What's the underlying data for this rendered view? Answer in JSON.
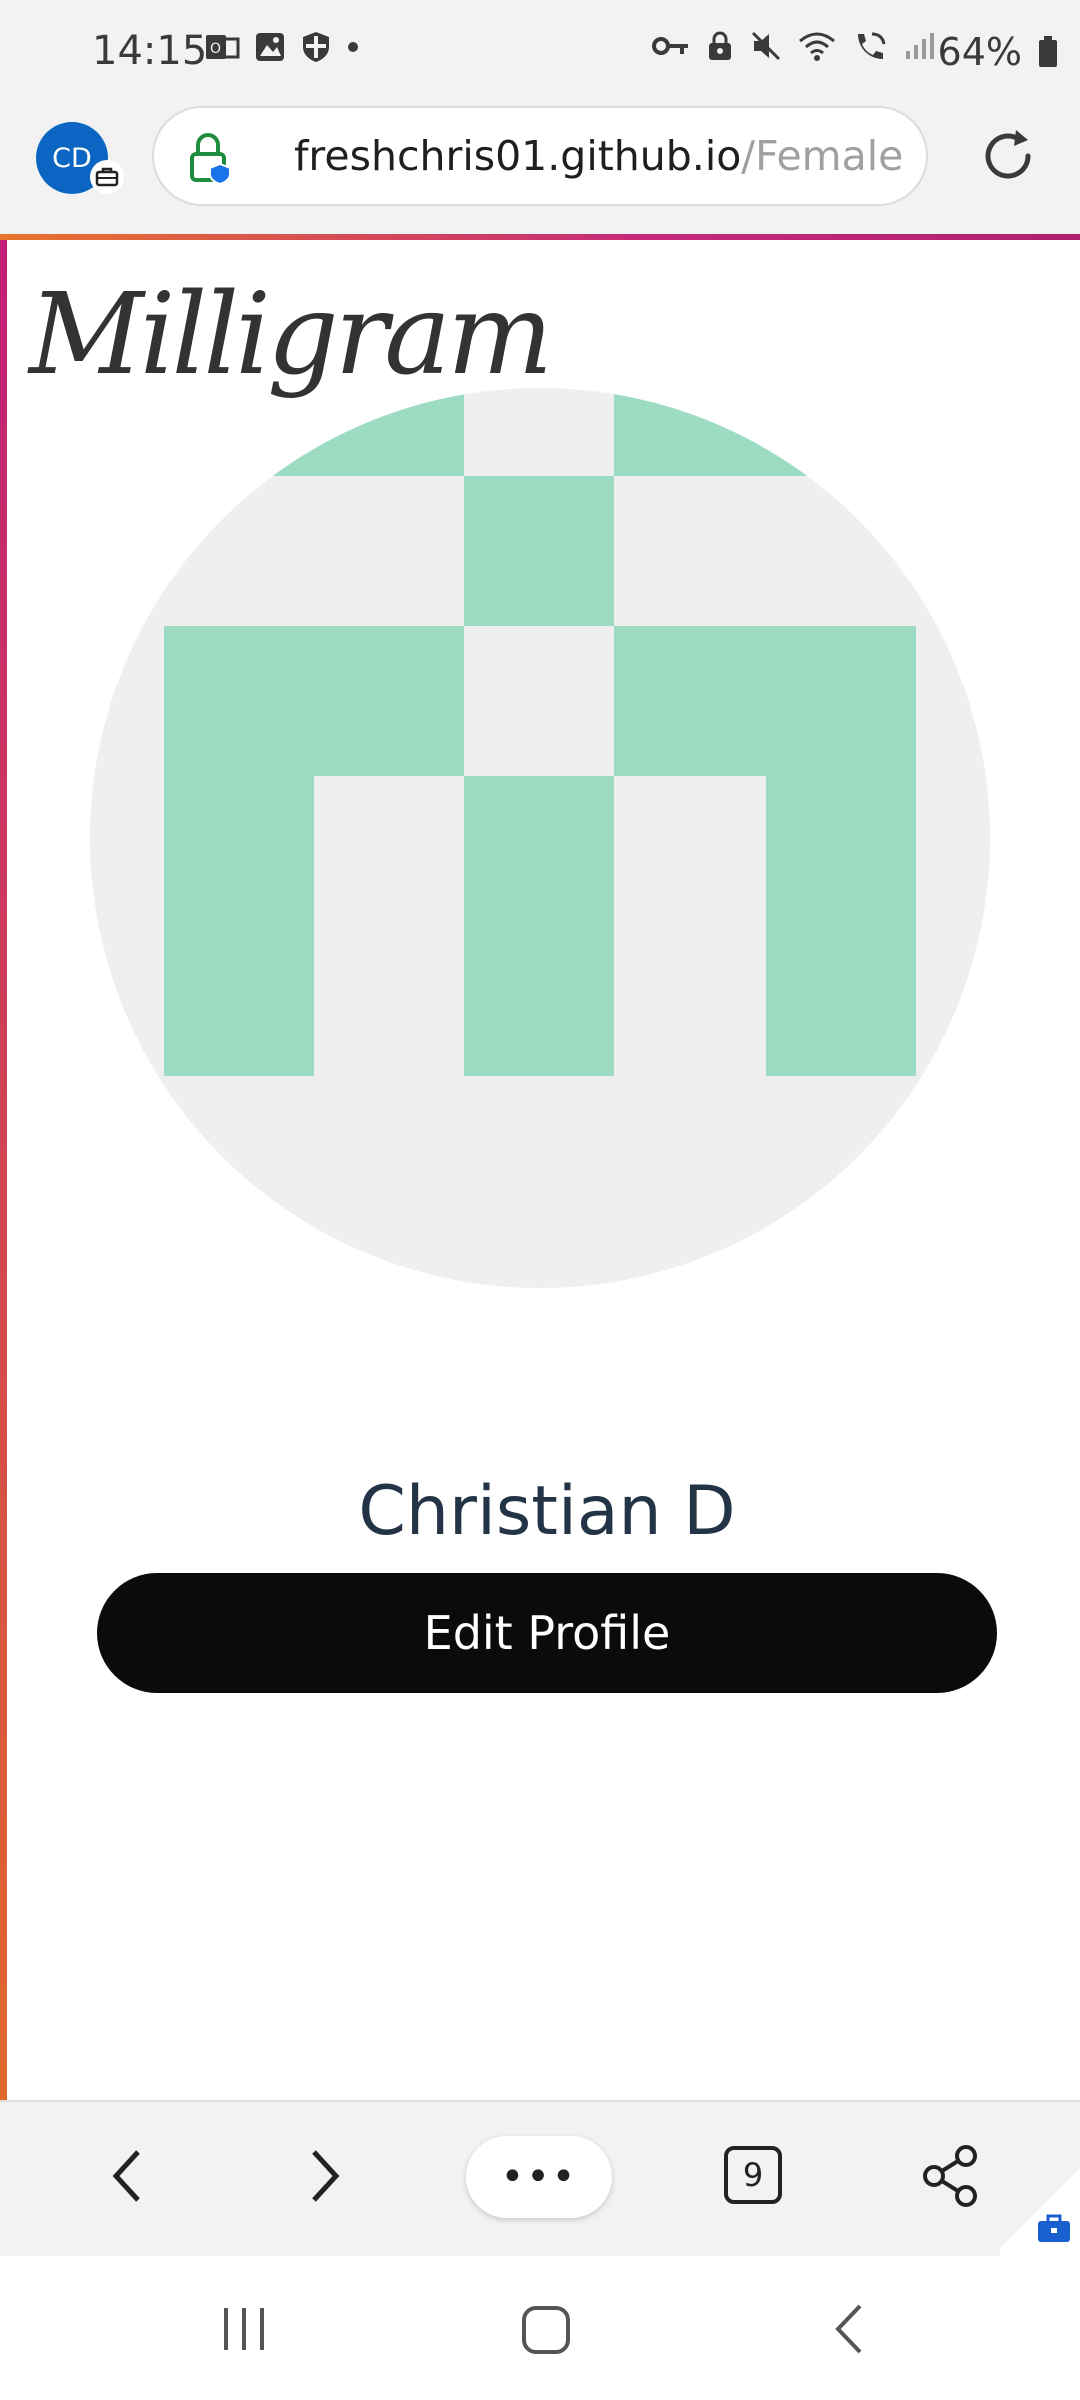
{
  "status_bar": {
    "time": "14:15",
    "battery": "64%",
    "left_icons": [
      "outlook-icon",
      "gallery-icon",
      "shield-icon",
      "notification-dot-icon"
    ],
    "right_icons": [
      "vpn-key-icon",
      "lock-icon",
      "mute-icon",
      "wifi-icon",
      "wifi-call-icon",
      "signal-icon",
      "battery-icon"
    ]
  },
  "browser": {
    "profile_initials": "CD",
    "url_domain": "freshchris01.github.io",
    "url_path": "/Female",
    "tab_count": "9",
    "more_label": "•••"
  },
  "page": {
    "logo": "Milligram",
    "profile_name": "Christian D",
    "edit_button_label": "Edit Profile",
    "avatar_colors": {
      "background": "#efefef",
      "pattern": "#9ddcc2"
    }
  },
  "colors": {
    "accent_start": "#e8742c",
    "accent_end": "#c6287a",
    "avatar_badge": "#0a66c2",
    "button": "#0b0b0b"
  }
}
